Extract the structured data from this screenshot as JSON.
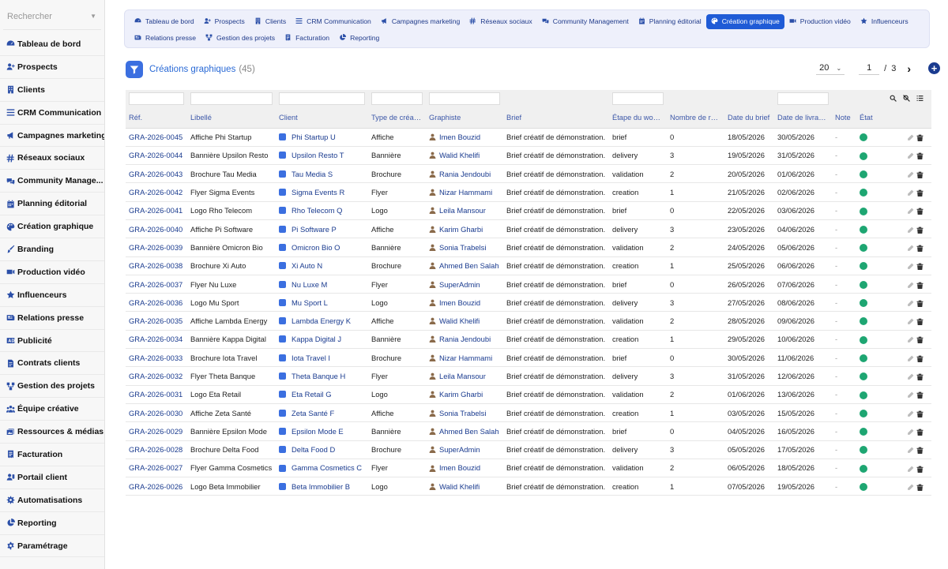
{
  "search": {
    "placeholder": "Rechercher"
  },
  "sidebar": {
    "items": [
      {
        "label": "Tableau de bord",
        "icon": "dashboard-icon"
      },
      {
        "label": "Prospects",
        "icon": "user-plus-icon"
      },
      {
        "label": "Clients",
        "icon": "building-icon"
      },
      {
        "label": "CRM Communication",
        "icon": "list-icon"
      },
      {
        "label": "Campagnes marketing",
        "icon": "megaphone-icon"
      },
      {
        "label": "Réseaux sociaux",
        "icon": "hashtag-icon"
      },
      {
        "label": "Community Manage...",
        "icon": "comments-icon"
      },
      {
        "label": "Planning éditorial",
        "icon": "calendar-icon"
      },
      {
        "label": "Création graphique",
        "icon": "palette-icon"
      },
      {
        "label": "Branding",
        "icon": "brush-icon"
      },
      {
        "label": "Production vidéo",
        "icon": "video-icon"
      },
      {
        "label": "Influenceurs",
        "icon": "star-icon"
      },
      {
        "label": "Relations presse",
        "icon": "newspaper-icon"
      },
      {
        "label": "Publicité",
        "icon": "ad-icon"
      },
      {
        "label": "Contrats clients",
        "icon": "contract-icon"
      },
      {
        "label": "Gestion des projets",
        "icon": "project-icon"
      },
      {
        "label": "Équipe créative",
        "icon": "team-icon"
      },
      {
        "label": "Ressources & médias",
        "icon": "media-icon"
      },
      {
        "label": "Facturation",
        "icon": "invoice-icon"
      },
      {
        "label": "Portail client",
        "icon": "portal-icon"
      },
      {
        "label": "Automatisations",
        "icon": "automation-icon"
      },
      {
        "label": "Reporting",
        "icon": "pie-icon"
      },
      {
        "label": "Paramétrage",
        "icon": "gear-icon"
      }
    ]
  },
  "topnav": {
    "row1": [
      {
        "label": "Tableau de bord",
        "icon": "dashboard-icon"
      },
      {
        "label": "Prospects",
        "icon": "user-plus-icon"
      },
      {
        "label": "Clients",
        "icon": "building-icon"
      },
      {
        "label": "CRM Communication",
        "icon": "list-icon"
      },
      {
        "label": "Campagnes marketing",
        "icon": "megaphone-icon"
      },
      {
        "label": "Réseaux sociaux",
        "icon": "hashtag-icon"
      },
      {
        "label": "Community Management",
        "icon": "comments-icon"
      },
      {
        "label": "Planning éditorial",
        "icon": "calendar-icon"
      },
      {
        "label": "Création graphique",
        "icon": "palette-icon",
        "active": true
      },
      {
        "label": "Production vidéo",
        "icon": "video-icon"
      },
      {
        "label": "Influenceurs",
        "icon": "star-icon"
      }
    ],
    "row2": [
      {
        "label": "Relations presse",
        "icon": "newspaper-icon"
      },
      {
        "label": "Gestion des projets",
        "icon": "project-icon"
      },
      {
        "label": "Facturation",
        "icon": "invoice-icon"
      },
      {
        "label": "Reporting",
        "icon": "pie-icon"
      }
    ]
  },
  "list": {
    "title": "Créations graphiques",
    "count": "(45)"
  },
  "pager": {
    "per_page": "20",
    "page": "1",
    "separator": "/",
    "total_pages": "3",
    "next": "›",
    "add": "+"
  },
  "table": {
    "columns": [
      "Réf.",
      "Libellé",
      "Client",
      "Type de créa…",
      "Graphiste",
      "Brief",
      "Étape du wo…",
      "Nombre de r…",
      "Date du brief",
      "Date de livra…",
      "Note",
      "État"
    ],
    "rows": [
      {
        "ref": "GRA-2026-0045",
        "libelle": "Affiche Phi Startup",
        "client": "Phi Startup U",
        "type": "Affiche",
        "graphiste": "Imen Bouzid",
        "brief": "Brief créatif de démonstration.",
        "etape": "brief",
        "nombre": "0",
        "date_brief": "18/05/2026",
        "date_livraison": "30/05/2026",
        "note": "-"
      },
      {
        "ref": "GRA-2026-0044",
        "libelle": "Bannière Upsilon Resto",
        "client": "Upsilon Resto T",
        "type": "Bannière",
        "graphiste": "Walid Khelifi",
        "brief": "Brief créatif de démonstration.",
        "etape": "delivery",
        "nombre": "3",
        "date_brief": "19/05/2026",
        "date_livraison": "31/05/2026",
        "note": "-"
      },
      {
        "ref": "GRA-2026-0043",
        "libelle": "Brochure Tau Media",
        "client": "Tau Media S",
        "type": "Brochure",
        "graphiste": "Rania Jendoubi",
        "brief": "Brief créatif de démonstration.",
        "etape": "validation",
        "nombre": "2",
        "date_brief": "20/05/2026",
        "date_livraison": "01/06/2026",
        "note": "-"
      },
      {
        "ref": "GRA-2026-0042",
        "libelle": "Flyer Sigma Events",
        "client": "Sigma Events R",
        "type": "Flyer",
        "graphiste": "Nizar Hammami",
        "brief": "Brief créatif de démonstration.",
        "etape": "creation",
        "nombre": "1",
        "date_brief": "21/05/2026",
        "date_livraison": "02/06/2026",
        "note": "-"
      },
      {
        "ref": "GRA-2026-0041",
        "libelle": "Logo Rho Telecom",
        "client": "Rho Telecom Q",
        "type": "Logo",
        "graphiste": "Leila Mansour",
        "brief": "Brief créatif de démonstration.",
        "etape": "brief",
        "nombre": "0",
        "date_brief": "22/05/2026",
        "date_livraison": "03/06/2026",
        "note": "-"
      },
      {
        "ref": "GRA-2026-0040",
        "libelle": "Affiche Pi Software",
        "client": "Pi Software P",
        "type": "Affiche",
        "graphiste": "Karim Gharbi",
        "brief": "Brief créatif de démonstration.",
        "etape": "delivery",
        "nombre": "3",
        "date_brief": "23/05/2026",
        "date_livraison": "04/06/2026",
        "note": "-"
      },
      {
        "ref": "GRA-2026-0039",
        "libelle": "Bannière Omicron Bio",
        "client": "Omicron Bio O",
        "type": "Bannière",
        "graphiste": "Sonia Trabelsi",
        "brief": "Brief créatif de démonstration.",
        "etape": "validation",
        "nombre": "2",
        "date_brief": "24/05/2026",
        "date_livraison": "05/06/2026",
        "note": "-"
      },
      {
        "ref": "GRA-2026-0038",
        "libelle": "Brochure Xi Auto",
        "client": "Xi Auto N",
        "type": "Brochure",
        "graphiste": "Ahmed Ben Salah",
        "brief": "Brief créatif de démonstration.",
        "etape": "creation",
        "nombre": "1",
        "date_brief": "25/05/2026",
        "date_livraison": "06/06/2026",
        "note": "-"
      },
      {
        "ref": "GRA-2026-0037",
        "libelle": "Flyer Nu Luxe",
        "client": "Nu Luxe M",
        "type": "Flyer",
        "graphiste": "SuperAdmin",
        "brief": "Brief créatif de démonstration.",
        "etape": "brief",
        "nombre": "0",
        "date_brief": "26/05/2026",
        "date_livraison": "07/06/2026",
        "note": "-"
      },
      {
        "ref": "GRA-2026-0036",
        "libelle": "Logo Mu Sport",
        "client": "Mu Sport L",
        "type": "Logo",
        "graphiste": "Imen Bouzid",
        "brief": "Brief créatif de démonstration.",
        "etape": "delivery",
        "nombre": "3",
        "date_brief": "27/05/2026",
        "date_livraison": "08/06/2026",
        "note": "-"
      },
      {
        "ref": "GRA-2026-0035",
        "libelle": "Affiche Lambda Energy",
        "client": "Lambda Energy K",
        "type": "Affiche",
        "graphiste": "Walid Khelifi",
        "brief": "Brief créatif de démonstration.",
        "etape": "validation",
        "nombre": "2",
        "date_brief": "28/05/2026",
        "date_livraison": "09/06/2026",
        "note": "-"
      },
      {
        "ref": "GRA-2026-0034",
        "libelle": "Bannière Kappa Digital",
        "client": "Kappa Digital J",
        "type": "Bannière",
        "graphiste": "Rania Jendoubi",
        "brief": "Brief créatif de démonstration.",
        "etape": "creation",
        "nombre": "1",
        "date_brief": "29/05/2026",
        "date_livraison": "10/06/2026",
        "note": "-"
      },
      {
        "ref": "GRA-2026-0033",
        "libelle": "Brochure Iota Travel",
        "client": "Iota Travel I",
        "type": "Brochure",
        "graphiste": "Nizar Hammami",
        "brief": "Brief créatif de démonstration.",
        "etape": "brief",
        "nombre": "0",
        "date_brief": "30/05/2026",
        "date_livraison": "11/06/2026",
        "note": "-"
      },
      {
        "ref": "GRA-2026-0032",
        "libelle": "Flyer Theta Banque",
        "client": "Theta Banque H",
        "type": "Flyer",
        "graphiste": "Leila Mansour",
        "brief": "Brief créatif de démonstration.",
        "etape": "delivery",
        "nombre": "3",
        "date_brief": "31/05/2026",
        "date_livraison": "12/06/2026",
        "note": "-"
      },
      {
        "ref": "GRA-2026-0031",
        "libelle": "Logo Eta Retail",
        "client": "Eta Retail G",
        "type": "Logo",
        "graphiste": "Karim Gharbi",
        "brief": "Brief créatif de démonstration.",
        "etape": "validation",
        "nombre": "2",
        "date_brief": "01/06/2026",
        "date_livraison": "13/06/2026",
        "note": "-"
      },
      {
        "ref": "GRA-2026-0030",
        "libelle": "Affiche Zeta Santé",
        "client": "Zeta Santé F",
        "type": "Affiche",
        "graphiste": "Sonia Trabelsi",
        "brief": "Brief créatif de démonstration.",
        "etape": "creation",
        "nombre": "1",
        "date_brief": "03/05/2026",
        "date_livraison": "15/05/2026",
        "note": "-"
      },
      {
        "ref": "GRA-2026-0029",
        "libelle": "Bannière Epsilon Mode",
        "client": "Epsilon Mode E",
        "type": "Bannière",
        "graphiste": "Ahmed Ben Salah",
        "brief": "Brief créatif de démonstration.",
        "etape": "brief",
        "nombre": "0",
        "date_brief": "04/05/2026",
        "date_livraison": "16/05/2026",
        "note": "-"
      },
      {
        "ref": "GRA-2026-0028",
        "libelle": "Brochure Delta Food",
        "client": "Delta Food D",
        "type": "Brochure",
        "graphiste": "SuperAdmin",
        "brief": "Brief créatif de démonstration.",
        "etape": "delivery",
        "nombre": "3",
        "date_brief": "05/05/2026",
        "date_livraison": "17/05/2026",
        "note": "-"
      },
      {
        "ref": "GRA-2026-0027",
        "libelle": "Flyer Gamma Cosmetics",
        "client": "Gamma Cosmetics C",
        "type": "Flyer",
        "graphiste": "Imen Bouzid",
        "brief": "Brief créatif de démonstration.",
        "etape": "validation",
        "nombre": "2",
        "date_brief": "06/05/2026",
        "date_livraison": "18/05/2026",
        "note": "-"
      },
      {
        "ref": "GRA-2026-0026",
        "libelle": "Logo Beta Immobilier",
        "client": "Beta Immobilier B",
        "type": "Logo",
        "graphiste": "Walid Khelifi",
        "brief": "Brief créatif de démonstration.",
        "etape": "creation",
        "nombre": "1",
        "date_brief": "07/05/2026",
        "date_livraison": "19/05/2026",
        "note": "-"
      }
    ]
  },
  "colors": {
    "accent": "#1f5bd6",
    "link": "#1a3b8f",
    "status_ok": "#1ea672",
    "nav_bg": "#eef0fb"
  }
}
